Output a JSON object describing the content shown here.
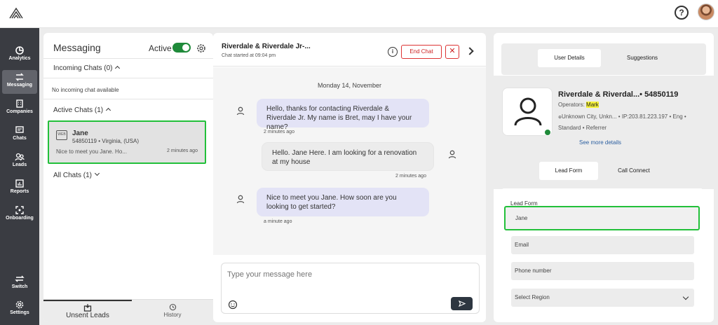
{
  "nav": {
    "items": [
      {
        "label": "Analytics",
        "icon": "analytics-icon"
      },
      {
        "label": "Messaging",
        "icon": "messaging-icon"
      },
      {
        "label": "Companies",
        "icon": "companies-icon"
      },
      {
        "label": "Chats",
        "icon": "chats-icon"
      },
      {
        "label": "Leads",
        "icon": "leads-icon"
      },
      {
        "label": "Reports",
        "icon": "reports-icon"
      },
      {
        "label": "Onboarding",
        "icon": "onboarding-icon"
      },
      {
        "label": "Switch",
        "icon": "switch-icon"
      },
      {
        "label": "Settings",
        "icon": "settings-icon"
      }
    ]
  },
  "header": {
    "help_symbol": "?"
  },
  "messaging": {
    "title": "Messaging",
    "active_label": "Active",
    "incoming_heading": "Incoming Chats (0)",
    "no_incoming": "No incoming chat available",
    "active_heading": "Active Chats (1)",
    "all_heading": "All Chats (1)",
    "chat_card": {
      "name": "Jane",
      "id_location": "54850119 • Virginia, (USA)",
      "preview": "Nice to meet you Jane. Ho...",
      "time": "2 minutes ago",
      "source_badge": "WEB"
    },
    "footer": {
      "unsent": "Unsent Leads",
      "history": "History"
    }
  },
  "chat": {
    "title": "Riverdale & Riverdale Jr-...",
    "subtitle": "Chat started at 09:04 pm",
    "end_chat": "End Chat",
    "close_symbol": "✕",
    "date": "Monday 14, November",
    "messages": [
      {
        "text": "Hello, thanks for contacting Riverdale & Riverdale Jr. My name is Bret, may I have your name?",
        "time": "2 minutes ago"
      },
      {
        "text": "Hello. Jane Here. I am looking for a renovation at my house",
        "time": "2 minutes ago"
      },
      {
        "text": "Nice to meet you Jane. How soon are you looking to get started?",
        "time": "a minute ago"
      }
    ],
    "composer_placeholder": "Type your message here"
  },
  "details": {
    "tabs": [
      "User Details",
      "Suggestions"
    ],
    "name": "Riverdale & Riverdal...• 54850119",
    "operators_label": "Operators:",
    "operator": "Mark",
    "location": "Unknown City, Unkn... • IP:203.81.223.197 • Eng •",
    "standard": "Standard • Referrer",
    "see_more": "See more details",
    "tabs2": [
      "Lead Form",
      "Call Connect"
    ],
    "form_label": "Lead Form",
    "fields": {
      "name_value": "Jane",
      "email_placeholder": "Email",
      "phone_placeholder": "Phone number",
      "region_placeholder": "Select Region"
    }
  },
  "colors": {
    "accent_green": "#22c03a",
    "toggle_green": "#1f8a3a",
    "nav_bg": "#3a3c42",
    "danger": "#d33333",
    "link": "#2c5fa0"
  }
}
